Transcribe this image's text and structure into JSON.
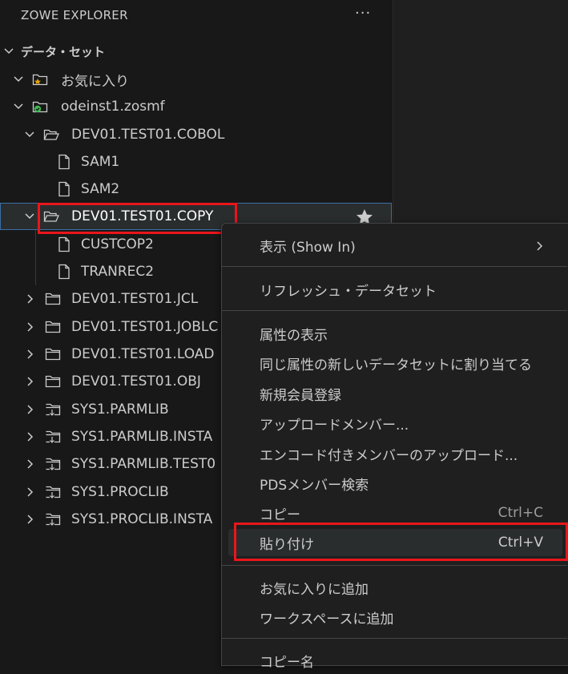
{
  "explorer": {
    "title": "ZOWE EXPLORER",
    "more": "···",
    "section": "データ・セット",
    "favorites": "お気に入り",
    "profile": "odeinst1.zosmf",
    "items": [
      {
        "label": "DEV01.TEST01.COBOL",
        "icon": "folder-open-icon"
      },
      {
        "label": "SAM1",
        "icon": "file-icon"
      },
      {
        "label": "SAM2",
        "icon": "file-icon"
      },
      {
        "label": "DEV01.TEST01.COPY",
        "icon": "folder-open-icon"
      },
      {
        "label": "CUSTCOP2",
        "icon": "file-icon"
      },
      {
        "label": "TRANREC2",
        "icon": "file-icon"
      },
      {
        "label": "DEV01.TEST01.JCL",
        "icon": "folder-icon"
      },
      {
        "label": "DEV01.TEST01.JOBLC",
        "icon": "folder-icon"
      },
      {
        "label": "DEV01.TEST01.LOAD",
        "icon": "folder-icon"
      },
      {
        "label": "DEV01.TEST01.OBJ",
        "icon": "folder-icon"
      },
      {
        "label": "SYS1.PARMLIB",
        "icon": "migrated-folder-icon"
      },
      {
        "label": "SYS1.PARMLIB.INSTA",
        "icon": "migrated-folder-icon"
      },
      {
        "label": "SYS1.PARMLIB.TEST0",
        "icon": "migrated-folder-icon"
      },
      {
        "label": "SYS1.PROCLIB",
        "icon": "migrated-folder-icon"
      },
      {
        "label": "SYS1.PROCLIB.INSTA",
        "icon": "migrated-folder-icon"
      }
    ]
  },
  "context_menu": {
    "show_in": "表示 (Show In)",
    "refresh": "リフレッシュ・データセット",
    "show_attributes": "属性の表示",
    "allocate_like": "同じ属性の新しいデータセットに割り当てる",
    "new_member": "新規会員登録",
    "upload_member": "アップロードメンバー...",
    "upload_encoded": "エンコード付きメンバーのアップロード...",
    "search_pds": "PDSメンバー検索",
    "copy": "コピー",
    "copy_key": "Ctrl+C",
    "paste": "貼り付け",
    "paste_key": "Ctrl+V",
    "add_favorite": "お気に入りに追加",
    "add_workspace": "ワークスペースに追加",
    "copy_name": "コピー名"
  },
  "colors": {
    "highlight": "#e8161b",
    "favorite_star": "#e5a50a",
    "profile_check": "#3fb950"
  }
}
